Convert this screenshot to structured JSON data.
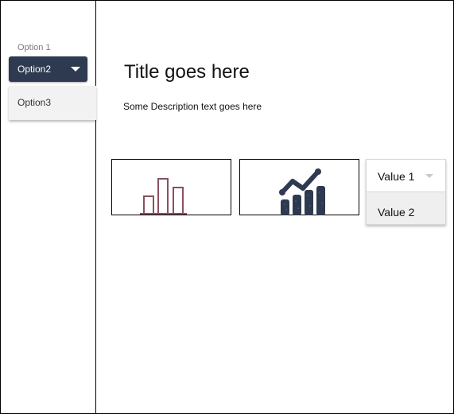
{
  "sidebar": {
    "select": {
      "label": "Option 1",
      "selected": "Option2",
      "options": [
        "Option3"
      ]
    }
  },
  "main": {
    "title": "Title goes here",
    "description": "Some Description text goes here"
  },
  "cards": [
    {
      "icon": "bar-chart-outline-icon",
      "color": "#8a5060"
    },
    {
      "icon": "growth-chart-icon",
      "color": "#2e3a50"
    }
  ],
  "value_dropdown": {
    "selected": "Value 1",
    "options": [
      "Value 2"
    ]
  },
  "colors": {
    "select_bg": "#2e3a50",
    "option_bg": "#f2f2f2",
    "bar_icon": "#8a5060",
    "growth_icon": "#2e3a50"
  }
}
